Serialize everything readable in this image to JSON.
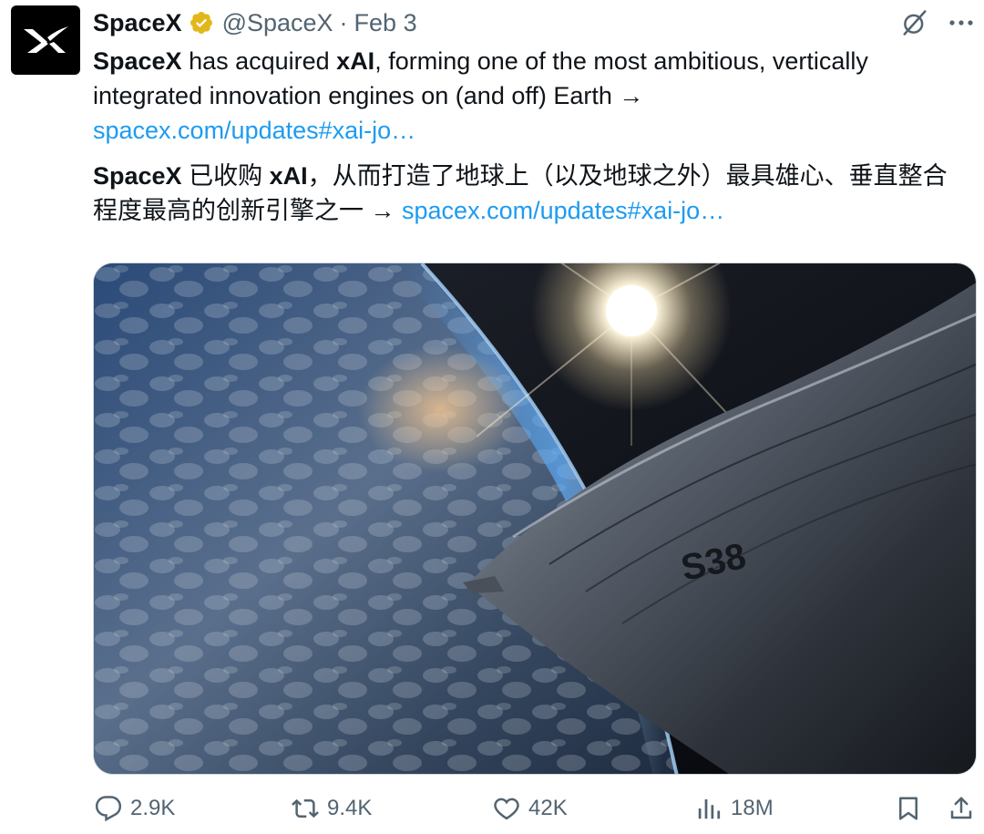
{
  "tweet": {
    "display_name": "SpaceX",
    "handle": "@SpaceX",
    "separator": "·",
    "date": "Feb 3",
    "verified_icon": "verified-badge-gold",
    "avatar_icon": "spacex-x-logo",
    "grok_icon": "grok-icon",
    "more_icon": "more-horizontal-icon",
    "text_en": {
      "bold_1": "SpaceX",
      "plain_1": " has acquired ",
      "bold_2": "xAI",
      "plain_2": ", forming one of the most ambitious, vertically integrated innovation engines on (and off) Earth →",
      "link": "spacex.com/updates#xai-jo…"
    },
    "text_zh": {
      "bold_1": "SpaceX",
      "plain_1": " 已收购 ",
      "bold_2": "xAI",
      "plain_2": "，从而打造了地球上（以及地球之外）最具雄心、垂直整合程度最高的创新引擎之一 → ",
      "link": "spacex.com/updates#xai-jo…"
    },
    "media": {
      "ship_label": "S38"
    },
    "actions": {
      "replies": "2.9K",
      "reposts": "9.4K",
      "likes": "42K",
      "views": "18M"
    }
  },
  "colors": {
    "text": "#0f1419",
    "secondary": "#536471",
    "link": "#1d9bf0",
    "verified": "#e2b719"
  }
}
